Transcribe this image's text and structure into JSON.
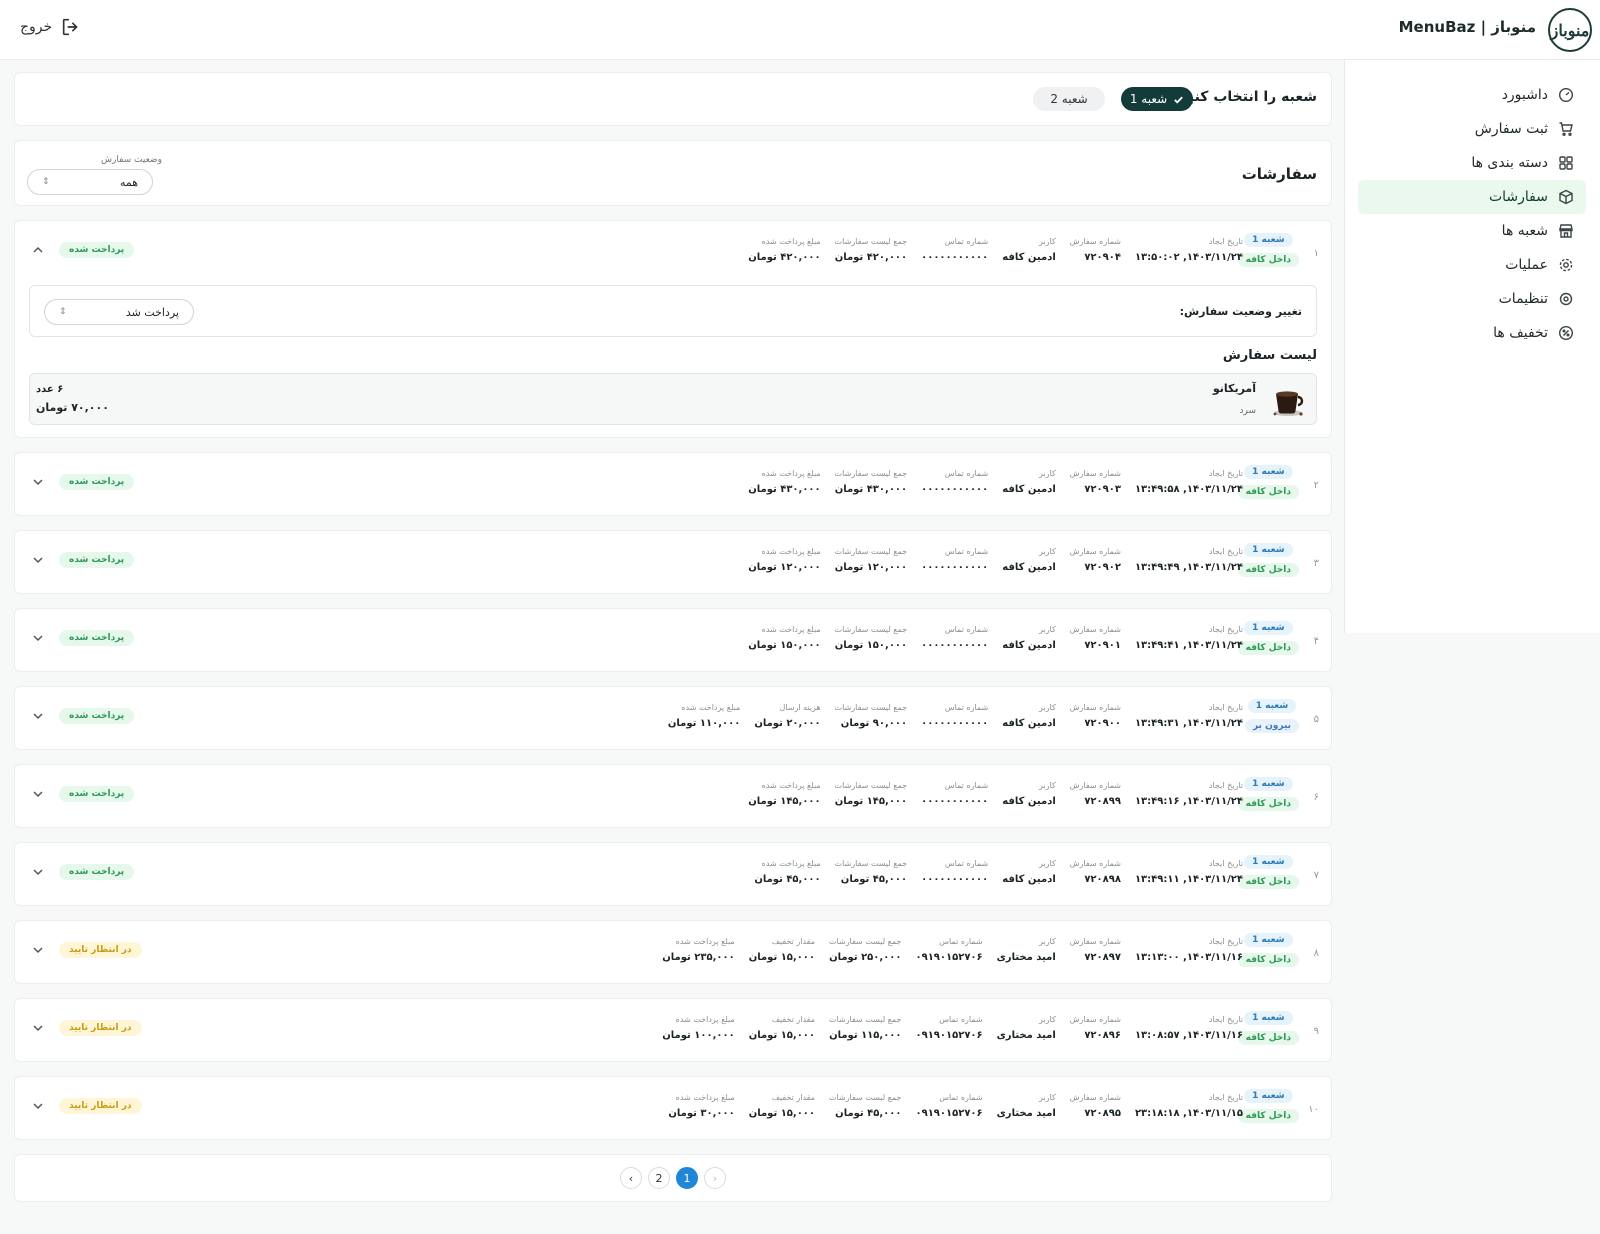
{
  "header": {
    "brand": "MenuBaz | منوباز",
    "logo_text": "منوباز",
    "logout": "خروج"
  },
  "sidebar": {
    "items": [
      {
        "label": "داشبورد",
        "icon": "dashboard-icon"
      },
      {
        "label": "ثبت سفارش",
        "icon": "cart-icon"
      },
      {
        "label": "دسته بندی ها",
        "icon": "grid-icon"
      },
      {
        "label": "سفارشات",
        "icon": "box-icon",
        "active": true
      },
      {
        "label": "شعبه ها",
        "icon": "store-icon"
      },
      {
        "label": "عملیات",
        "icon": "gear-icon"
      },
      {
        "label": "تنظیمات",
        "icon": "settings-icon"
      },
      {
        "label": "تخفیف ها",
        "icon": "percent-icon"
      }
    ]
  },
  "branch_select": {
    "title": "شعبه را انتخاب کنید:",
    "options": [
      "شعبه 1",
      "شعبه 2"
    ],
    "selected": "شعبه 1"
  },
  "orders": {
    "title": "سفارشات",
    "filter_label": "وضعیت سفارش",
    "filter_value": "همه",
    "change_status_label": "تغییر وضعیت سفارش:",
    "change_status_value": "پرداخت شد",
    "list_title": "لیست سفارش",
    "expanded_item": {
      "name": "آمریکانو",
      "variant": "سرد",
      "qty": "۶ عدد",
      "price": "۷۰,۰۰۰ تومان"
    },
    "rows": [
      {
        "idx": "۱",
        "branch": "شعبه 1",
        "type": "داخل کافه",
        "type_kind": "dine",
        "status": "پرداخت شده",
        "status_kind": "paid",
        "expanded": true,
        "fields": [
          [
            "تاریخ ایجاد",
            "۱۴۰۳/۱۱/۲۴, ۱۳:۵۰:۰۲"
          ],
          [
            "شماره سفارش",
            "۷۲۰۹۰۴"
          ],
          [
            "کاربر",
            "ادمین کافه"
          ],
          [
            "شماره تماس",
            "۰۰۰۰۰۰۰۰۰۰۰"
          ],
          [
            "جمع لیست سفارشات",
            "۴۲۰,۰۰۰ تومان"
          ],
          [
            "مبلغ پرداخت شده",
            "۴۲۰,۰۰۰ تومان"
          ]
        ]
      },
      {
        "idx": "۲",
        "branch": "شعبه 1",
        "type": "داخل کافه",
        "type_kind": "dine",
        "status": "پرداخت شده",
        "status_kind": "paid",
        "fields": [
          [
            "تاریخ ایجاد",
            "۱۴۰۳/۱۱/۲۴, ۱۳:۴۹:۵۸"
          ],
          [
            "شماره سفارش",
            "۷۲۰۹۰۳"
          ],
          [
            "کاربر",
            "ادمین کافه"
          ],
          [
            "شماره تماس",
            "۰۰۰۰۰۰۰۰۰۰۰"
          ],
          [
            "جمع لیست سفارشات",
            "۴۳۰,۰۰۰ تومان"
          ],
          [
            "مبلغ پرداخت شده",
            "۴۳۰,۰۰۰ تومان"
          ]
        ]
      },
      {
        "idx": "۳",
        "branch": "شعبه 1",
        "type": "داخل کافه",
        "type_kind": "dine",
        "status": "پرداخت شده",
        "status_kind": "paid",
        "fields": [
          [
            "تاریخ ایجاد",
            "۱۴۰۳/۱۱/۲۴, ۱۳:۴۹:۴۹"
          ],
          [
            "شماره سفارش",
            "۷۲۰۹۰۲"
          ],
          [
            "کاربر",
            "ادمین کافه"
          ],
          [
            "شماره تماس",
            "۰۰۰۰۰۰۰۰۰۰۰"
          ],
          [
            "جمع لیست سفارشات",
            "۱۲۰,۰۰۰ تومان"
          ],
          [
            "مبلغ پرداخت شده",
            "۱۲۰,۰۰۰ تومان"
          ]
        ]
      },
      {
        "idx": "۴",
        "branch": "شعبه 1",
        "type": "داخل کافه",
        "type_kind": "dine",
        "status": "پرداخت شده",
        "status_kind": "paid",
        "fields": [
          [
            "تاریخ ایجاد",
            "۱۴۰۳/۱۱/۲۴, ۱۳:۴۹:۴۱"
          ],
          [
            "شماره سفارش",
            "۷۲۰۹۰۱"
          ],
          [
            "کاربر",
            "ادمین کافه"
          ],
          [
            "شماره تماس",
            "۰۰۰۰۰۰۰۰۰۰۰"
          ],
          [
            "جمع لیست سفارشات",
            "۱۵۰,۰۰۰ تومان"
          ],
          [
            "مبلغ پرداخت شده",
            "۱۵۰,۰۰۰ تومان"
          ]
        ]
      },
      {
        "idx": "۵",
        "branch": "شعبه 1",
        "type": "بیرون بر",
        "type_kind": "out",
        "status": "پرداخت شده",
        "status_kind": "paid",
        "fields": [
          [
            "تاریخ ایجاد",
            "۱۴۰۳/۱۱/۲۴, ۱۳:۴۹:۳۱"
          ],
          [
            "شماره سفارش",
            "۷۲۰۹۰۰"
          ],
          [
            "کاربر",
            "ادمین کافه"
          ],
          [
            "شماره تماس",
            "۰۰۰۰۰۰۰۰۰۰۰"
          ],
          [
            "جمع لیست سفارشات",
            "۹۰,۰۰۰ تومان"
          ],
          [
            "هزینه ارسال",
            "۲۰,۰۰۰ تومان"
          ],
          [
            "مبلغ پرداخت شده",
            "۱۱۰,۰۰۰ تومان"
          ]
        ]
      },
      {
        "idx": "۶",
        "branch": "شعبه 1",
        "type": "داخل کافه",
        "type_kind": "dine",
        "status": "پرداخت شده",
        "status_kind": "paid",
        "fields": [
          [
            "تاریخ ایجاد",
            "۱۴۰۳/۱۱/۲۴, ۱۳:۴۹:۱۶"
          ],
          [
            "شماره سفارش",
            "۷۲۰۸۹۹"
          ],
          [
            "کاربر",
            "ادمین کافه"
          ],
          [
            "شماره تماس",
            "۰۰۰۰۰۰۰۰۰۰۰"
          ],
          [
            "جمع لیست سفارشات",
            "۱۴۵,۰۰۰ تومان"
          ],
          [
            "مبلغ پرداخت شده",
            "۱۴۵,۰۰۰ تومان"
          ]
        ]
      },
      {
        "idx": "۷",
        "branch": "شعبه 1",
        "type": "داخل کافه",
        "type_kind": "dine",
        "status": "پرداخت شده",
        "status_kind": "paid",
        "fields": [
          [
            "تاریخ ایجاد",
            "۱۴۰۳/۱۱/۲۴, ۱۳:۴۹:۱۱"
          ],
          [
            "شماره سفارش",
            "۷۲۰۸۹۸"
          ],
          [
            "کاربر",
            "ادمین کافه"
          ],
          [
            "شماره تماس",
            "۰۰۰۰۰۰۰۰۰۰۰"
          ],
          [
            "جمع لیست سفارشات",
            "۴۵,۰۰۰ تومان"
          ],
          [
            "مبلغ پرداخت شده",
            "۴۵,۰۰۰ تومان"
          ]
        ]
      },
      {
        "idx": "۸",
        "branch": "شعبه 1",
        "type": "داخل کافه",
        "type_kind": "dine",
        "status": "در انتظار تایید",
        "status_kind": "pend",
        "fields": [
          [
            "تاریخ ایجاد",
            "۱۴۰۳/۱۱/۱۶, ۱۳:۱۳:۰۰"
          ],
          [
            "شماره سفارش",
            "۷۲۰۸۹۷"
          ],
          [
            "کاربر",
            "امید مختاری"
          ],
          [
            "شماره تماس",
            "۰۹۱۹۰۱۵۲۷۰۶"
          ],
          [
            "جمع لیست سفارشات",
            "۲۵۰,۰۰۰ تومان"
          ],
          [
            "مقدار تخفیف",
            "۱۵,۰۰۰ تومان"
          ],
          [
            "مبلغ پرداخت شده",
            "۲۳۵,۰۰۰ تومان"
          ]
        ]
      },
      {
        "idx": "۹",
        "branch": "شعبه 1",
        "type": "داخل کافه",
        "type_kind": "dine",
        "status": "در انتظار تایید",
        "status_kind": "pend",
        "fields": [
          [
            "تاریخ ایجاد",
            "۱۴۰۳/۱۱/۱۶, ۱۳:۰۸:۵۷"
          ],
          [
            "شماره سفارش",
            "۷۲۰۸۹۶"
          ],
          [
            "کاربر",
            "امید مختاری"
          ],
          [
            "شماره تماس",
            "۰۹۱۹۰۱۵۲۷۰۶"
          ],
          [
            "جمع لیست سفارشات",
            "۱۱۵,۰۰۰ تومان"
          ],
          [
            "مقدار تخفیف",
            "۱۵,۰۰۰ تومان"
          ],
          [
            "مبلغ پرداخت شده",
            "۱۰۰,۰۰۰ تومان"
          ]
        ]
      },
      {
        "idx": "۱۰",
        "branch": "شعبه 1",
        "type": "داخل کافه",
        "type_kind": "dine",
        "status": "در انتظار تایید",
        "status_kind": "pend",
        "fields": [
          [
            "تاریخ ایجاد",
            "۱۴۰۳/۱۱/۱۵, ۲۳:۱۸:۱۸"
          ],
          [
            "شماره سفارش",
            "۷۲۰۸۹۵"
          ],
          [
            "کاربر",
            "امید مختاری"
          ],
          [
            "شماره تماس",
            "۰۹۱۹۰۱۵۲۷۰۶"
          ],
          [
            "جمع لیست سفارشات",
            "۴۵,۰۰۰ تومان"
          ],
          [
            "مقدار تخفیف",
            "۱۵,۰۰۰ تومان"
          ],
          [
            "مبلغ پرداخت شده",
            "۳۰,۰۰۰ تومان"
          ]
        ]
      }
    ]
  },
  "pagination": {
    "prev": "‹",
    "next": "›",
    "pages": [
      "1",
      "2"
    ],
    "current": "1"
  },
  "colors": {
    "brand_dark": "#123b3a",
    "active_nav_bg": "#eaf8ee",
    "paid": "#2f9a56",
    "pending": "#c99a12",
    "page_active": "#1f86d8"
  }
}
